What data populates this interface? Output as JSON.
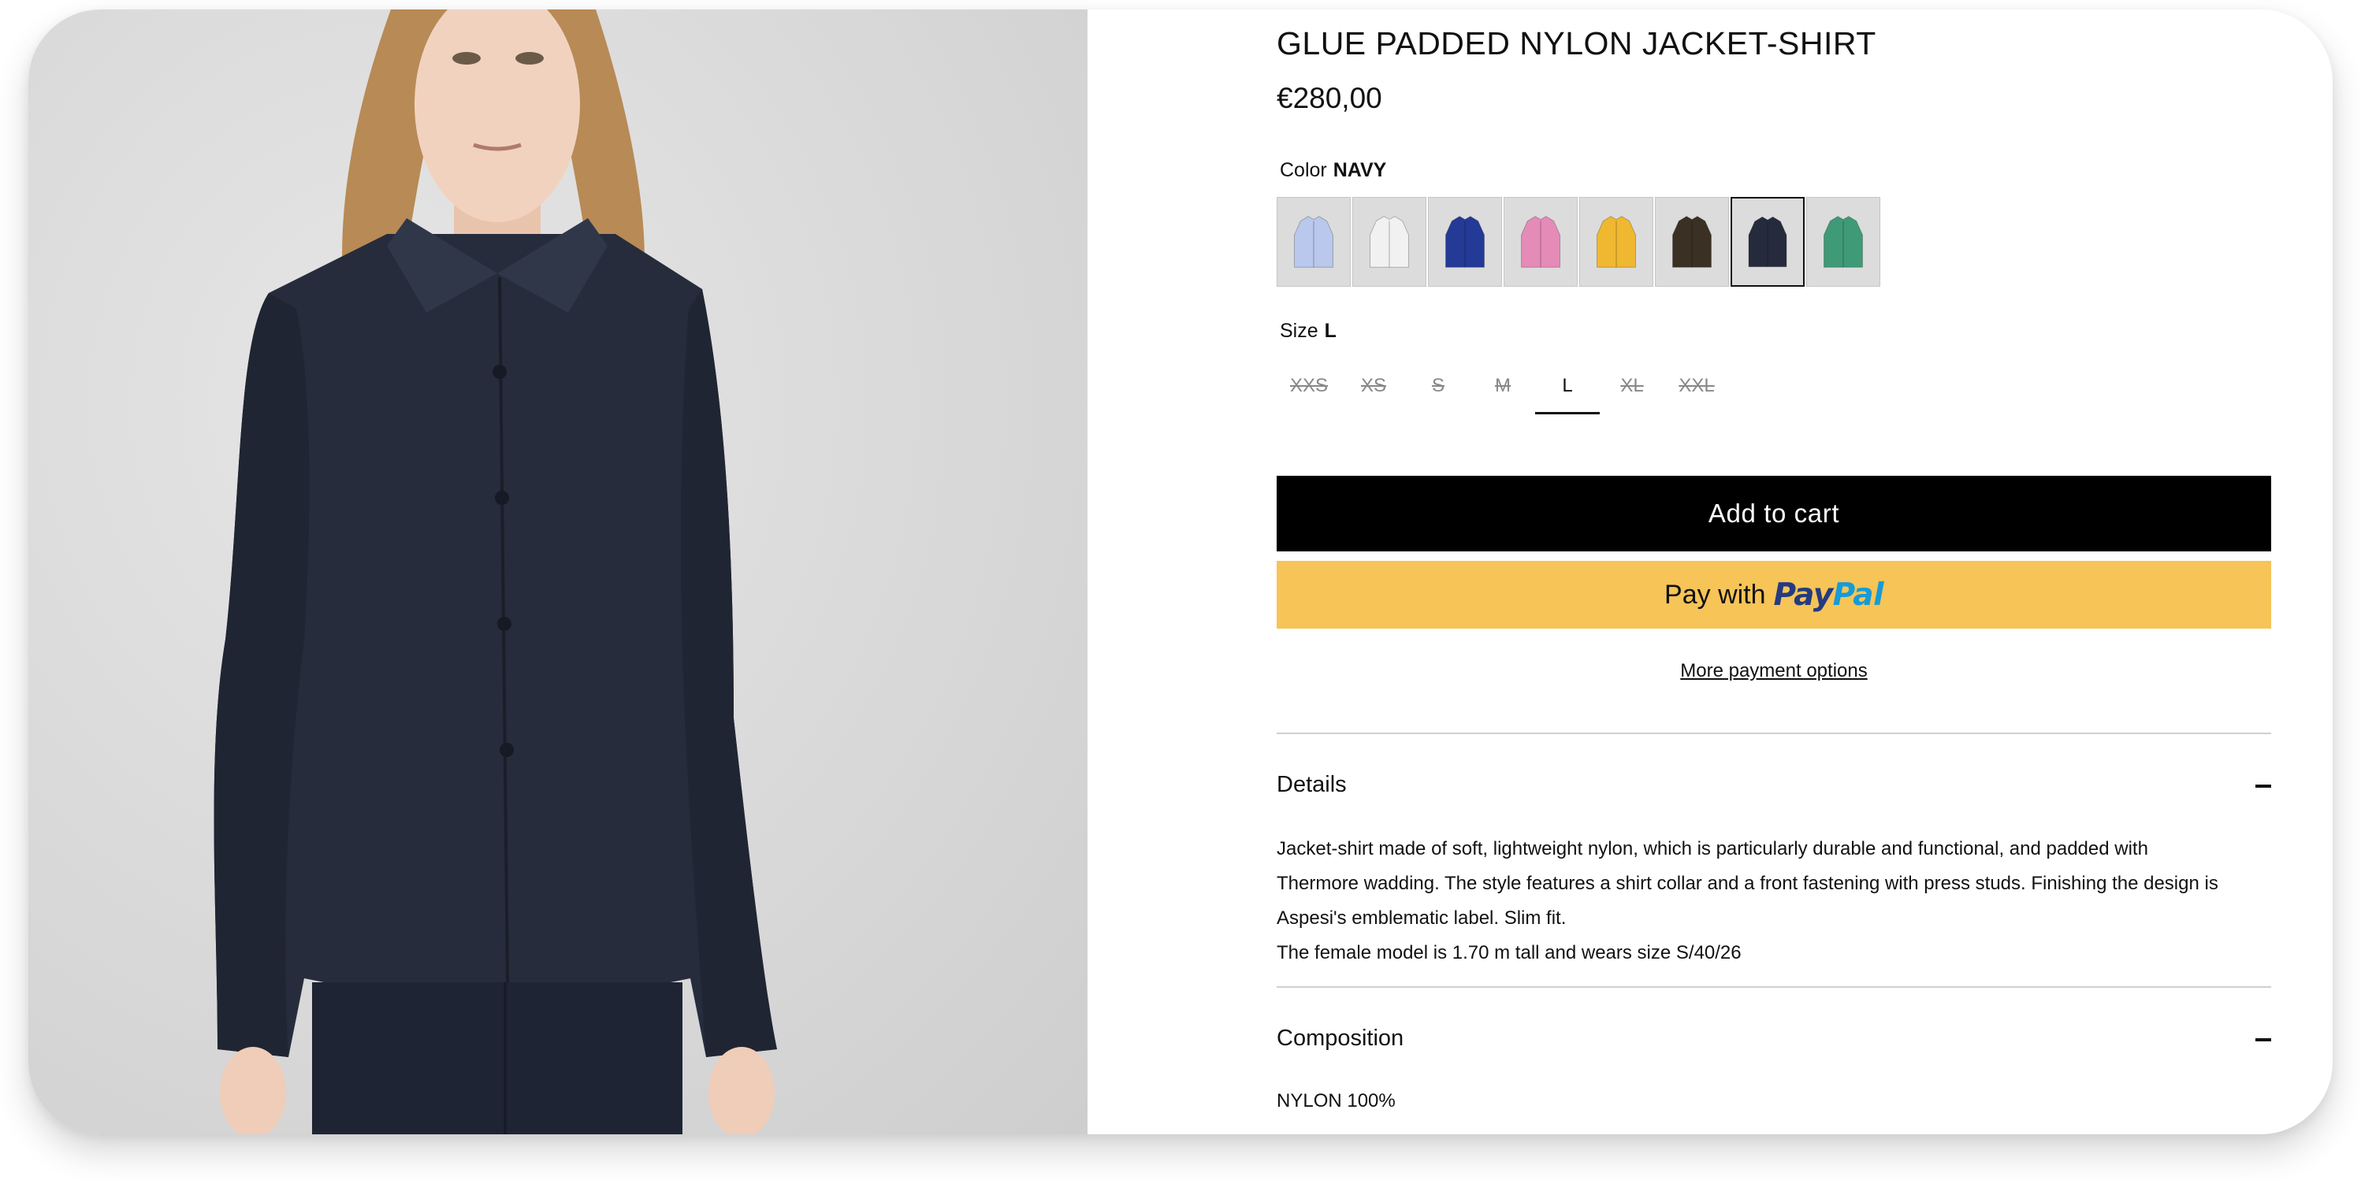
{
  "product": {
    "title": "GLUE PADDED NYLON JACKET-SHIRT",
    "price": "€280,00"
  },
  "color": {
    "label": "Color",
    "selected": "NAVY",
    "swatches": [
      {
        "name": "light-blue",
        "hex": "#b9c8ec"
      },
      {
        "name": "white",
        "hex": "#f1f1f1"
      },
      {
        "name": "royal-blue",
        "hex": "#243a97"
      },
      {
        "name": "pink",
        "hex": "#e58bb8"
      },
      {
        "name": "yellow",
        "hex": "#f0b830"
      },
      {
        "name": "dark-brown",
        "hex": "#3a3124"
      },
      {
        "name": "navy",
        "hex": "#252b3c",
        "selected": true
      },
      {
        "name": "green",
        "hex": "#3f9a78"
      }
    ]
  },
  "size": {
    "label": "Size",
    "selected": "L",
    "options": [
      "XXS",
      "XS",
      "S",
      "M",
      "L",
      "XL",
      "XXL"
    ]
  },
  "buttons": {
    "add_to_cart": "Add to cart",
    "pay_with": "Pay with",
    "paypal_a": "Pay",
    "paypal_b": "Pal",
    "more_payment": "More payment options"
  },
  "details": {
    "title": "Details",
    "lines": [
      "Jacket-shirt made of soft, lightweight nylon, which is particularly durable and functional, and padded with",
      "Thermore wadding. The style features a shirt collar and a front fastening with press studs. Finishing the design is",
      "Aspesi's emblematic label. Slim fit.",
      "The female model is 1.70 m tall and wears size S/40/26"
    ]
  },
  "composition": {
    "title": "Composition",
    "text": "NYLON 100%"
  },
  "colors": {
    "accent_black": "#000000",
    "paypal_yellow": "#f6c457",
    "jacket_navy": "#262c3b"
  }
}
